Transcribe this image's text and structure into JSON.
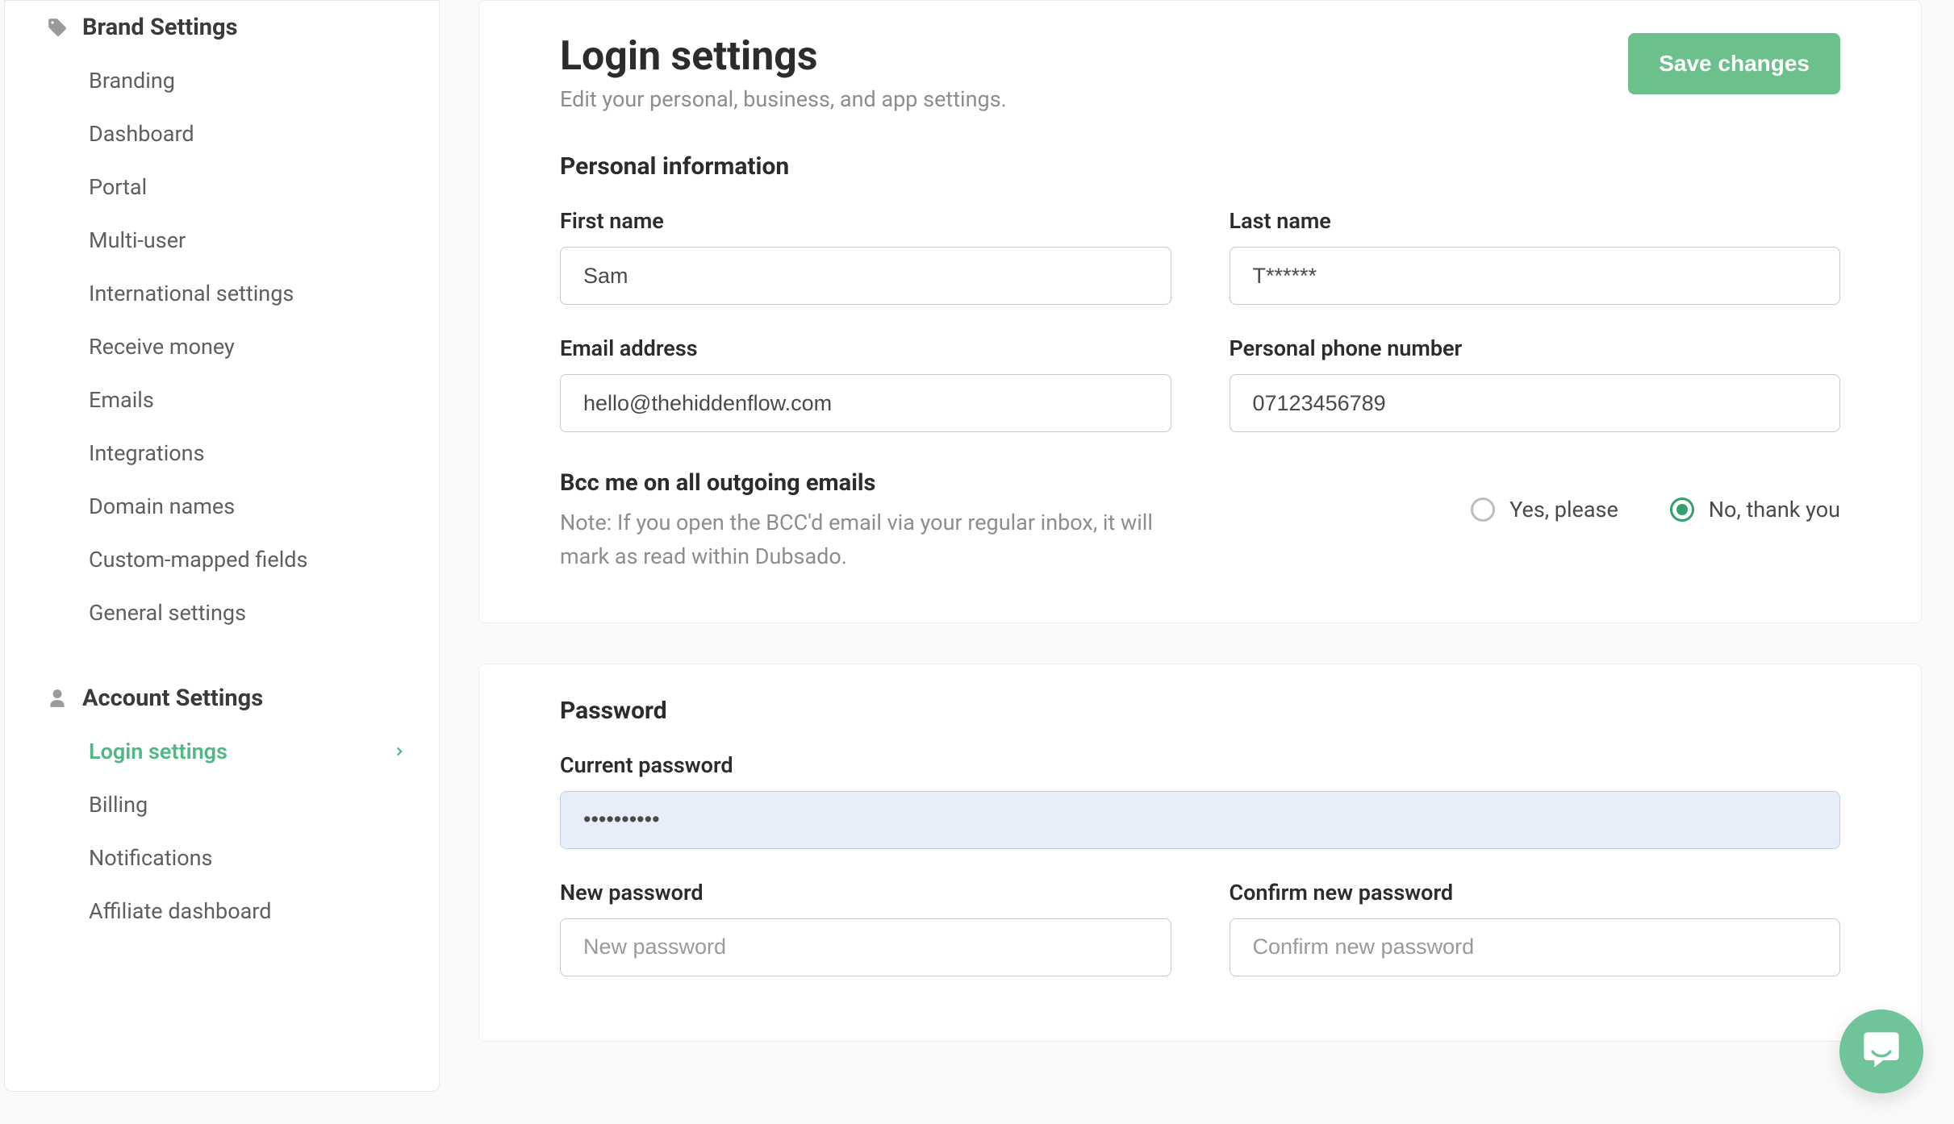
{
  "sidebar": {
    "brand": {
      "header": "Brand Settings",
      "items": [
        {
          "label": "Branding"
        },
        {
          "label": "Dashboard"
        },
        {
          "label": "Portal"
        },
        {
          "label": "Multi-user"
        },
        {
          "label": "International settings"
        },
        {
          "label": "Receive money"
        },
        {
          "label": "Emails"
        },
        {
          "label": "Integrations"
        },
        {
          "label": "Domain names"
        },
        {
          "label": "Custom-mapped fields"
        },
        {
          "label": "General settings"
        }
      ]
    },
    "account": {
      "header": "Account Settings",
      "items": [
        {
          "label": "Login settings",
          "active": true
        },
        {
          "label": "Billing"
        },
        {
          "label": "Notifications"
        },
        {
          "label": "Affiliate dashboard"
        }
      ]
    }
  },
  "header": {
    "title": "Login settings",
    "subtitle": "Edit your personal, business, and app settings.",
    "save_label": "Save changes"
  },
  "personal": {
    "section_title": "Personal information",
    "first_name_label": "First name",
    "first_name_value": "Sam",
    "last_name_label": "Last name",
    "last_name_value": "T******",
    "email_label": "Email address",
    "email_value": "hello@thehiddenflow.com",
    "phone_label": "Personal phone number",
    "phone_value": "07123456789"
  },
  "bcc": {
    "title": "Bcc me on all outgoing emails",
    "note": "Note: If you open the BCC'd email via your regular inbox, it will mark as read within Dubsado.",
    "yes_label": "Yes, please",
    "no_label": "No, thank you",
    "selected": "no"
  },
  "password": {
    "section_title": "Password",
    "current_label": "Current password",
    "current_value": "••••••••••",
    "new_label": "New password",
    "new_placeholder": "New password",
    "confirm_label": "Confirm new password",
    "confirm_placeholder": "Confirm new password"
  }
}
